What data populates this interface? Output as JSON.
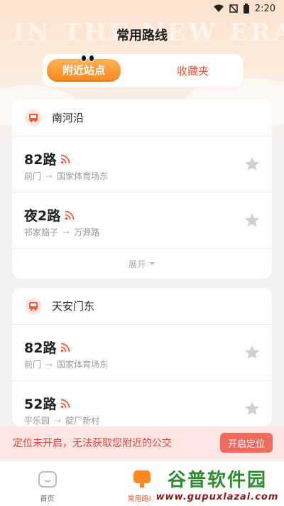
{
  "status_bar": {
    "time": "2:20"
  },
  "page": {
    "title": "常用路线",
    "bg_text": "IN THE NEW ERA"
  },
  "tabs": [
    {
      "label": "附近站点",
      "active": true
    },
    {
      "label": "收藏夹",
      "active": false
    }
  ],
  "stations": [
    {
      "name": "南河沿",
      "routes": [
        {
          "name": "82路",
          "from": "前门",
          "to": "国家体育场东"
        },
        {
          "name": "夜2路",
          "from": "祁家豁子",
          "to": "万源路"
        }
      ],
      "expand_label": "展开"
    },
    {
      "name": "天安门东",
      "routes": [
        {
          "name": "82路",
          "from": "前门",
          "to": "国家体育场东"
        },
        {
          "name": "52路",
          "from": "平乐园",
          "to": "靛厂新村"
        }
      ]
    }
  ],
  "banner": {
    "text": "定位未开启，无法获取您附近的公交",
    "button": "开启定位"
  },
  "bottom_nav": [
    {
      "label": "首页",
      "icon": "home-icon"
    },
    {
      "label": "常用路线",
      "icon": "route-icon",
      "active": true
    }
  ],
  "watermark": {
    "main": "谷普软件园",
    "sub": "www.gupuxlazai.com"
  },
  "colors": {
    "accent": "#ff8a1f",
    "alert": "#e2473f",
    "signal": "#f05a3c"
  }
}
